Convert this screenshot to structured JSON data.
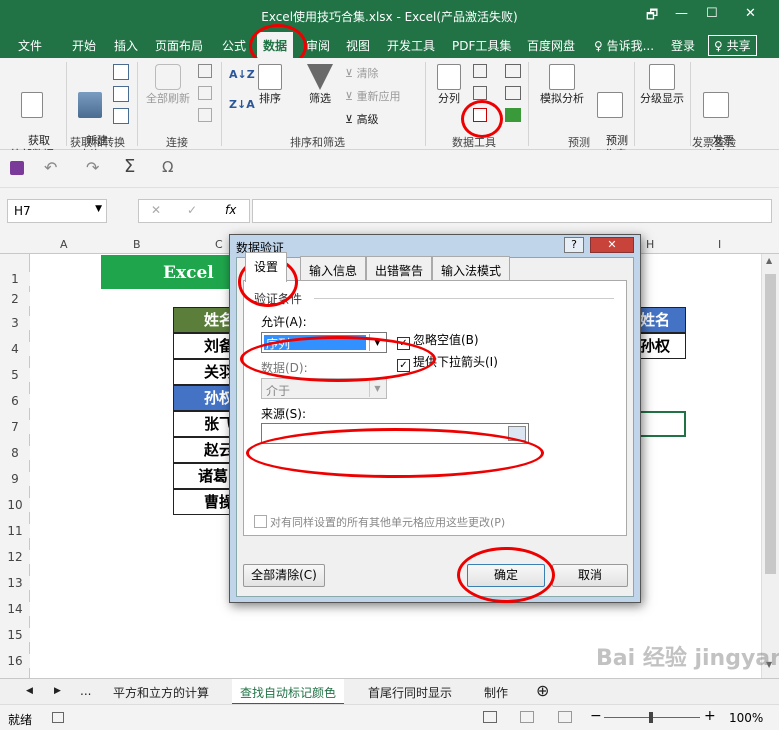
{
  "window": {
    "title": "Excel使用技巧合集.xlsx - Excel(产品激活失败)",
    "controls": [
      "🗗",
      "—",
      "☐",
      "✕"
    ]
  },
  "tabs": [
    "文件",
    "开始",
    "插入",
    "页面布局",
    "公式",
    "数据",
    "审阅",
    "视图",
    "开发工具",
    "PDF工具集",
    "百度网盘",
    "♀ 告诉我...",
    "登录",
    "♀ 共享"
  ],
  "ribbon": {
    "get_external": "获取\n外部数据",
    "new_query": "新建\n查询",
    "refresh_all": "全部刷新",
    "sort_az": "A↓Z",
    "sort": "排序",
    "filter": "筛选",
    "clear": "清除",
    "reapply": "重新应用",
    "advanced": "高级",
    "split": "分列",
    "what_if": "模拟分析",
    "forecast_sheet": "预测\n工作表",
    "outline": "分级显示",
    "send_check": "发票\n查验",
    "groups": [
      "获取和转换",
      "连接",
      "排序和筛选",
      "数据工具",
      "预测",
      "发票查验"
    ]
  },
  "namebox": "H7",
  "fx": "fx",
  "columns": [
    "A",
    "B",
    "C",
    "H",
    "I"
  ],
  "rows": [
    "1",
    "2",
    "3",
    "4",
    "5",
    "6",
    "7",
    "8",
    "9",
    "10",
    "11",
    "12",
    "13",
    "14",
    "15",
    "16"
  ],
  "sheet": {
    "title": "Excel",
    "names": [
      "姓名",
      "刘备",
      "关羽",
      "孙权",
      "张飞",
      "赵云",
      "诸葛",
      "曹操"
    ],
    "right_header": "姓名",
    "right_value": "孙权"
  },
  "dialog": {
    "title": "数据验证",
    "help": "?",
    "close": "✕",
    "tabs": [
      "设置",
      "输入信息",
      "出错警告",
      "输入法模式"
    ],
    "section": "验证条件",
    "allow_label": "允许(A):",
    "allow_value": "序列",
    "ignore_blank": "忽略空值(B)",
    "dropdown": "提供下拉箭头(I)",
    "data_label": "数据(D):",
    "data_value": "介于",
    "source_label": "来源(S):",
    "source_value": "",
    "apply_all": "对有同样设置的所有其他单元格应用这些更改(P)",
    "clear_all": "全部清除(C)",
    "ok": "确定",
    "cancel": "取消"
  },
  "sheet_tabs": [
    "...",
    "平方和立方的计算",
    "查找自动标记颜色",
    "首尾行同时显示",
    "制作",
    "⊕"
  ],
  "status": {
    "ready": "就绪",
    "zoom": "100%"
  },
  "watermark": "Bai 经验 jingyan.baidu.com",
  "colors": {
    "excel_green": "#217346",
    "header_green": "#5b7f3b",
    "blue_cell": "#4472c4",
    "title_green": "#1fa64c",
    "oval_red": "#ee0000"
  }
}
